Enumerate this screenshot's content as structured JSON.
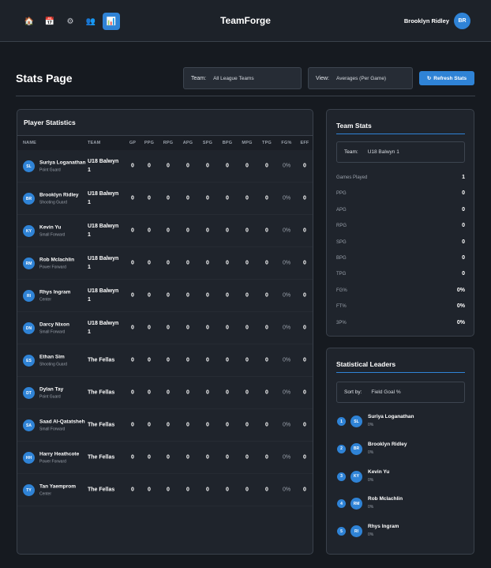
{
  "nav": {
    "icons": [
      {
        "name": "home-icon",
        "glyph": "🏠",
        "active": false
      },
      {
        "name": "calendar-icon",
        "glyph": "📅",
        "active": false
      },
      {
        "name": "gear-icon",
        "glyph": "⚙",
        "active": false
      },
      {
        "name": "users-icon",
        "glyph": "👥",
        "active": false
      },
      {
        "name": "stats-icon",
        "glyph": "📊",
        "active": true
      }
    ],
    "brand": "TeamForge",
    "user_name": "Brooklyn Ridley",
    "user_initials": "BR"
  },
  "header": {
    "title": "Stats Page",
    "team_label": "Team:",
    "team_value": "All League Teams",
    "view_label": "View:",
    "view_value": "Averages (Per Game)",
    "refresh_label": "Refresh Stats"
  },
  "players_panel": {
    "title": "Player Statistics",
    "columns": [
      "NAME",
      "TEAM",
      "GP",
      "PPG",
      "RPG",
      "APG",
      "SPG",
      "BPG",
      "MPG",
      "TPG",
      "FG%",
      "EFF"
    ],
    "rows": [
      {
        "initials": "SL",
        "name": "Suriya Loganathan",
        "position": "Point Guard",
        "team": "U18 Balwyn 1",
        "gp": "0",
        "ppg": "0",
        "rpg": "0",
        "apg": "0",
        "spg": "0",
        "bpg": "0",
        "mpg": "0",
        "tpg": "0",
        "fg": "0%",
        "eff": "0"
      },
      {
        "initials": "BR",
        "name": "Brooklyn Ridley",
        "position": "Shooting Guard",
        "team": "U18 Balwyn 1",
        "gp": "0",
        "ppg": "0",
        "rpg": "0",
        "apg": "0",
        "spg": "0",
        "bpg": "0",
        "mpg": "0",
        "tpg": "0",
        "fg": "0%",
        "eff": "0"
      },
      {
        "initials": "KY",
        "name": "Kevin Yu",
        "position": "Small Forward",
        "team": "U18 Balwyn 1",
        "gp": "0",
        "ppg": "0",
        "rpg": "0",
        "apg": "0",
        "spg": "0",
        "bpg": "0",
        "mpg": "0",
        "tpg": "0",
        "fg": "0%",
        "eff": "0"
      },
      {
        "initials": "RM",
        "name": "Rob Mclachlin",
        "position": "Power Forward",
        "team": "U18 Balwyn 1",
        "gp": "0",
        "ppg": "0",
        "rpg": "0",
        "apg": "0",
        "spg": "0",
        "bpg": "0",
        "mpg": "0",
        "tpg": "0",
        "fg": "0%",
        "eff": "0"
      },
      {
        "initials": "RI",
        "name": "Rhys Ingram",
        "position": "Center",
        "team": "U18 Balwyn 1",
        "gp": "0",
        "ppg": "0",
        "rpg": "0",
        "apg": "0",
        "spg": "0",
        "bpg": "0",
        "mpg": "0",
        "tpg": "0",
        "fg": "0%",
        "eff": "0"
      },
      {
        "initials": "DN",
        "name": "Darcy Nixon",
        "position": "Small Forward",
        "team": "U18 Balwyn 1",
        "gp": "0",
        "ppg": "0",
        "rpg": "0",
        "apg": "0",
        "spg": "0",
        "bpg": "0",
        "mpg": "0",
        "tpg": "0",
        "fg": "0%",
        "eff": "0"
      },
      {
        "initials": "ES",
        "name": "Ethan Sim",
        "position": "Shooting Guard",
        "team": "The Fellas",
        "gp": "0",
        "ppg": "0",
        "rpg": "0",
        "apg": "0",
        "spg": "0",
        "bpg": "0",
        "mpg": "0",
        "tpg": "0",
        "fg": "0%",
        "eff": "0"
      },
      {
        "initials": "DT",
        "name": "Dylan Tay",
        "position": "Point Guard",
        "team": "The Fellas",
        "gp": "0",
        "ppg": "0",
        "rpg": "0",
        "apg": "0",
        "spg": "0",
        "bpg": "0",
        "mpg": "0",
        "tpg": "0",
        "fg": "0%",
        "eff": "0"
      },
      {
        "initials": "SA",
        "name": "Saad Al-Qatatsheh",
        "position": "Small Forward",
        "team": "The Fellas",
        "gp": "0",
        "ppg": "0",
        "rpg": "0",
        "apg": "0",
        "spg": "0",
        "bpg": "0",
        "mpg": "0",
        "tpg": "0",
        "fg": "0%",
        "eff": "0"
      },
      {
        "initials": "HH",
        "name": "Harry Heathcote",
        "position": "Power Forward",
        "team": "The Fellas",
        "gp": "0",
        "ppg": "0",
        "rpg": "0",
        "apg": "0",
        "spg": "0",
        "bpg": "0",
        "mpg": "0",
        "tpg": "0",
        "fg": "0%",
        "eff": "0"
      },
      {
        "initials": "TY",
        "name": "Tan Yaemprom",
        "position": "Center",
        "team": "The Fellas",
        "gp": "0",
        "ppg": "0",
        "rpg": "0",
        "apg": "0",
        "spg": "0",
        "bpg": "0",
        "mpg": "0",
        "tpg": "0",
        "fg": "0%",
        "eff": "0"
      }
    ]
  },
  "team_stats": {
    "title": "Team Stats",
    "team_label": "Team:",
    "team_value": "U18 Balwyn 1",
    "stats": [
      {
        "label": "Games Played",
        "value": "1"
      },
      {
        "label": "PPG",
        "value": "0"
      },
      {
        "label": "APG",
        "value": "0"
      },
      {
        "label": "RPG",
        "value": "0"
      },
      {
        "label": "SPG",
        "value": "0"
      },
      {
        "label": "BPG",
        "value": "0"
      },
      {
        "label": "TPG",
        "value": "0"
      },
      {
        "label": "FG%",
        "value": "0%"
      },
      {
        "label": "FT%",
        "value": "0%"
      },
      {
        "label": "3P%",
        "value": "0%"
      }
    ]
  },
  "leaders": {
    "title": "Statistical Leaders",
    "sort_label": "Sort by:",
    "sort_value": "Field Goal %",
    "items": [
      {
        "rank": "1",
        "initials": "SL",
        "name": "Suriya Loganathan",
        "value": "0%"
      },
      {
        "rank": "2",
        "initials": "BR",
        "name": "Brooklyn Ridley",
        "value": "0%"
      },
      {
        "rank": "3",
        "initials": "KY",
        "name": "Kevin Yu",
        "value": "0%"
      },
      {
        "rank": "4",
        "initials": "RM",
        "name": "Rob Mclachlin",
        "value": "0%"
      },
      {
        "rank": "5",
        "initials": "RI",
        "name": "Rhys Ingram",
        "value": "0%"
      }
    ]
  },
  "colors": {
    "accent": "#2f83d6",
    "background": "#161a20",
    "panel": "#1f242c"
  }
}
